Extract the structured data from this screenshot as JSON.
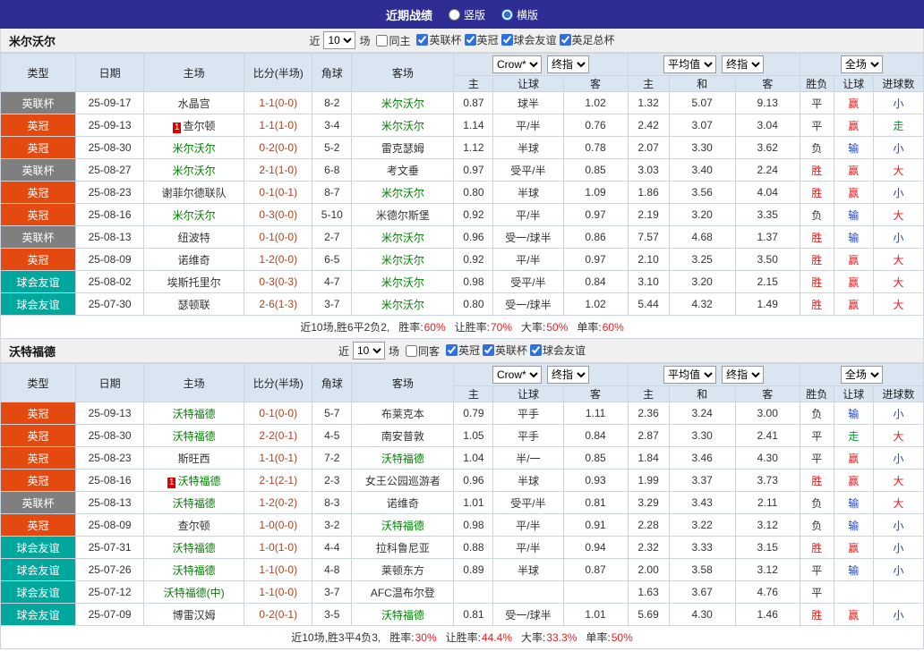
{
  "topbar": {
    "title": "近期战绩",
    "layout_options": [
      {
        "label": "竖版",
        "selected": false
      },
      {
        "label": "横版",
        "selected": true
      }
    ]
  },
  "labels": {
    "near": "近",
    "games": "场"
  },
  "selects": {
    "count": "10",
    "bookmaker": "Crow*",
    "stage": "终指",
    "average": "平均值",
    "scope": "全场"
  },
  "columns": {
    "main": [
      "类型",
      "日期",
      "主场",
      "比分(半场)",
      "角球",
      "客场"
    ],
    "sub": [
      "主",
      "让球",
      "客",
      "主",
      "和",
      "客",
      "胜负",
      "让球",
      "进球数"
    ]
  },
  "colors": {
    "topbar_bg": "#2d2d93",
    "table_header_bg": "#d9e6f2",
    "league_cup_gray": "#7f7f7f",
    "league_championship_red": "#e4490f",
    "friendly_teal": "#00a79d",
    "focal_team_green": "#008000",
    "score_color": "#aa4422",
    "win_red": "#e02020",
    "lose_blue": "#2244cc",
    "push_green": "#009933"
  },
  "sections": [
    {
      "team": "米尔沃尔",
      "same_venue": {
        "label": "同主",
        "checked": false
      },
      "leagues": [
        {
          "label": "英联杯",
          "checked": true
        },
        {
          "label": "英冠",
          "checked": true
        },
        {
          "label": "球会友谊",
          "checked": true
        },
        {
          "label": "英足总杯",
          "checked": true
        }
      ],
      "rows": [
        {
          "league": "英联杯",
          "league_color": "gray",
          "date": "25-09-17",
          "home": "水晶宫",
          "home_focal": false,
          "home_rank": "",
          "score": "1-1(0-0)",
          "corners": "8-2",
          "away": "米尔沃尔",
          "away_focal": true,
          "odds": [
            "0.87",
            "球半",
            "1.02"
          ],
          "euro": [
            "1.32",
            "5.07",
            "9.13"
          ],
          "results": [
            {
              "t": "平",
              "c": "dark"
            },
            {
              "t": "赢",
              "c": "red"
            },
            {
              "t": "小",
              "c": "blue"
            }
          ]
        },
        {
          "league": "英冠",
          "league_color": "red",
          "date": "25-09-13",
          "home": "查尔顿",
          "home_focal": false,
          "home_rank": "1",
          "score": "1-1(1-0)",
          "corners": "3-4",
          "away": "米尔沃尔",
          "away_focal": true,
          "odds": [
            "1.14",
            "平/半",
            "0.76"
          ],
          "euro": [
            "2.42",
            "3.07",
            "3.04"
          ],
          "results": [
            {
              "t": "平",
              "c": "dark"
            },
            {
              "t": "赢",
              "c": "red"
            },
            {
              "t": "走",
              "c": "green"
            }
          ]
        },
        {
          "league": "英冠",
          "league_color": "red",
          "date": "25-08-30",
          "home": "米尔沃尔",
          "home_focal": true,
          "home_rank": "",
          "score": "0-2(0-0)",
          "corners": "5-2",
          "away": "雷克瑟姆",
          "away_focal": false,
          "odds": [
            "1.12",
            "半球",
            "0.78"
          ],
          "euro": [
            "2.07",
            "3.30",
            "3.62"
          ],
          "results": [
            {
              "t": "负",
              "c": "dark"
            },
            {
              "t": "输",
              "c": "blue"
            },
            {
              "t": "小",
              "c": "blue"
            }
          ]
        },
        {
          "league": "英联杯",
          "league_color": "gray",
          "date": "25-08-27",
          "home": "米尔沃尔",
          "home_focal": true,
          "home_rank": "",
          "score": "2-1(1-0)",
          "corners": "6-8",
          "away": "考文垂",
          "away_focal": false,
          "odds": [
            "0.97",
            "受平/半",
            "0.85"
          ],
          "euro": [
            "3.03",
            "3.40",
            "2.24"
          ],
          "results": [
            {
              "t": "胜",
              "c": "red"
            },
            {
              "t": "赢",
              "c": "red"
            },
            {
              "t": "大",
              "c": "red"
            }
          ]
        },
        {
          "league": "英冠",
          "league_color": "red",
          "date": "25-08-23",
          "home": "谢菲尔德联队",
          "home_focal": false,
          "home_rank": "",
          "score": "0-1(0-1)",
          "corners": "8-7",
          "away": "米尔沃尔",
          "away_focal": true,
          "odds": [
            "0.80",
            "半球",
            "1.09"
          ],
          "euro": [
            "1.86",
            "3.56",
            "4.04"
          ],
          "results": [
            {
              "t": "胜",
              "c": "red"
            },
            {
              "t": "赢",
              "c": "red"
            },
            {
              "t": "小",
              "c": "blue"
            }
          ]
        },
        {
          "league": "英冠",
          "league_color": "red",
          "date": "25-08-16",
          "home": "米尔沃尔",
          "home_focal": true,
          "home_rank": "",
          "score": "0-3(0-0)",
          "corners": "5-10",
          "away": "米德尔斯堡",
          "away_focal": false,
          "odds": [
            "0.92",
            "平/半",
            "0.97"
          ],
          "euro": [
            "2.19",
            "3.20",
            "3.35"
          ],
          "results": [
            {
              "t": "负",
              "c": "dark"
            },
            {
              "t": "输",
              "c": "blue"
            },
            {
              "t": "大",
              "c": "red"
            }
          ]
        },
        {
          "league": "英联杯",
          "league_color": "gray",
          "date": "25-08-13",
          "home": "纽波特",
          "home_focal": false,
          "home_rank": "",
          "score": "0-1(0-0)",
          "corners": "2-7",
          "away": "米尔沃尔",
          "away_focal": true,
          "odds": [
            "0.96",
            "受一/球半",
            "0.86"
          ],
          "euro": [
            "7.57",
            "4.68",
            "1.37"
          ],
          "results": [
            {
              "t": "胜",
              "c": "red"
            },
            {
              "t": "输",
              "c": "blue"
            },
            {
              "t": "小",
              "c": "blue"
            }
          ]
        },
        {
          "league": "英冠",
          "league_color": "red",
          "date": "25-08-09",
          "home": "诺维奇",
          "home_focal": false,
          "home_rank": "",
          "score": "1-2(0-0)",
          "corners": "6-5",
          "away": "米尔沃尔",
          "away_focal": true,
          "odds": [
            "0.92",
            "平/半",
            "0.97"
          ],
          "euro": [
            "2.10",
            "3.25",
            "3.50"
          ],
          "results": [
            {
              "t": "胜",
              "c": "red"
            },
            {
              "t": "赢",
              "c": "red"
            },
            {
              "t": "大",
              "c": "red"
            }
          ]
        },
        {
          "league": "球会友谊",
          "league_color": "teal",
          "date": "25-08-02",
          "home": "埃斯托里尔",
          "home_focal": false,
          "home_rank": "",
          "score": "0-3(0-3)",
          "corners": "4-7",
          "away": "米尔沃尔",
          "away_focal": true,
          "odds": [
            "0.98",
            "受平/半",
            "0.84"
          ],
          "euro": [
            "3.10",
            "3.20",
            "2.15"
          ],
          "results": [
            {
              "t": "胜",
              "c": "red"
            },
            {
              "t": "赢",
              "c": "red"
            },
            {
              "t": "大",
              "c": "red"
            }
          ]
        },
        {
          "league": "球会友谊",
          "league_color": "teal",
          "date": "25-07-30",
          "home": "瑟顿联",
          "home_focal": false,
          "home_rank": "",
          "score": "2-6(1-3)",
          "corners": "3-7",
          "away": "米尔沃尔",
          "away_focal": true,
          "odds": [
            "0.80",
            "受一/球半",
            "1.02"
          ],
          "euro": [
            "5.44",
            "4.32",
            "1.49"
          ],
          "results": [
            {
              "t": "胜",
              "c": "red"
            },
            {
              "t": "赢",
              "c": "red"
            },
            {
              "t": "大",
              "c": "red"
            }
          ]
        }
      ],
      "summary": {
        "lead": "近10场,胜6平2负2,",
        "stats": [
          {
            "label": "胜率:",
            "value": "60%"
          },
          {
            "label": "让胜率:",
            "value": "70%"
          },
          {
            "label": "大率:",
            "value": "50%"
          },
          {
            "label": "单率:",
            "value": "60%"
          }
        ]
      }
    },
    {
      "team": "沃特福德",
      "same_venue": {
        "label": "同客",
        "checked": false
      },
      "leagues": [
        {
          "label": "英冠",
          "checked": true
        },
        {
          "label": "英联杯",
          "checked": true
        },
        {
          "label": "球会友谊",
          "checked": true
        }
      ],
      "rows": [
        {
          "league": "英冠",
          "league_color": "red",
          "date": "25-09-13",
          "home": "沃特福德",
          "home_focal": true,
          "home_rank": "",
          "score": "0-1(0-0)",
          "corners": "5-7",
          "away": "布莱克本",
          "away_focal": false,
          "odds": [
            "0.79",
            "平手",
            "1.11"
          ],
          "euro": [
            "2.36",
            "3.24",
            "3.00"
          ],
          "results": [
            {
              "t": "负",
              "c": "dark"
            },
            {
              "t": "输",
              "c": "blue"
            },
            {
              "t": "小",
              "c": "blue"
            }
          ]
        },
        {
          "league": "英冠",
          "league_color": "red",
          "date": "25-08-30",
          "home": "沃特福德",
          "home_focal": true,
          "home_rank": "",
          "score": "2-2(0-1)",
          "corners": "4-5",
          "away": "南安普敦",
          "away_focal": false,
          "odds": [
            "1.05",
            "平手",
            "0.84"
          ],
          "euro": [
            "2.87",
            "3.30",
            "2.41"
          ],
          "results": [
            {
              "t": "平",
              "c": "dark"
            },
            {
              "t": "走",
              "c": "green"
            },
            {
              "t": "大",
              "c": "red"
            }
          ]
        },
        {
          "league": "英冠",
          "league_color": "red",
          "date": "25-08-23",
          "home": "斯旺西",
          "home_focal": false,
          "home_rank": "",
          "score": "1-1(0-1)",
          "corners": "7-2",
          "away": "沃特福德",
          "away_focal": true,
          "odds": [
            "1.04",
            "半/一",
            "0.85"
          ],
          "euro": [
            "1.84",
            "3.46",
            "4.30"
          ],
          "results": [
            {
              "t": "平",
              "c": "dark"
            },
            {
              "t": "赢",
              "c": "red"
            },
            {
              "t": "小",
              "c": "blue"
            }
          ]
        },
        {
          "league": "英冠",
          "league_color": "red",
          "date": "25-08-16",
          "home": "沃特福德",
          "home_focal": true,
          "home_rank": "1",
          "score": "2-1(2-1)",
          "corners": "2-3",
          "away": "女王公园巡游者",
          "away_focal": false,
          "odds": [
            "0.96",
            "半球",
            "0.93"
          ],
          "euro": [
            "1.99",
            "3.37",
            "3.73"
          ],
          "results": [
            {
              "t": "胜",
              "c": "red"
            },
            {
              "t": "赢",
              "c": "red"
            },
            {
              "t": "大",
              "c": "red"
            }
          ]
        },
        {
          "league": "英联杯",
          "league_color": "gray",
          "date": "25-08-13",
          "home": "沃特福德",
          "home_focal": true,
          "home_rank": "",
          "score": "1-2(0-2)",
          "corners": "8-3",
          "away": "诺维奇",
          "away_focal": false,
          "odds": [
            "1.01",
            "受平/半",
            "0.81"
          ],
          "euro": [
            "3.29",
            "3.43",
            "2.11"
          ],
          "results": [
            {
              "t": "负",
              "c": "dark"
            },
            {
              "t": "输",
              "c": "blue"
            },
            {
              "t": "大",
              "c": "red"
            }
          ]
        },
        {
          "league": "英冠",
          "league_color": "red",
          "date": "25-08-09",
          "home": "查尔顿",
          "home_focal": false,
          "home_rank": "",
          "score": "1-0(0-0)",
          "corners": "3-2",
          "away": "沃特福德",
          "away_focal": true,
          "odds": [
            "0.98",
            "平/半",
            "0.91"
          ],
          "euro": [
            "2.28",
            "3.22",
            "3.12"
          ],
          "results": [
            {
              "t": "负",
              "c": "dark"
            },
            {
              "t": "输",
              "c": "blue"
            },
            {
              "t": "小",
              "c": "blue"
            }
          ]
        },
        {
          "league": "球会友谊",
          "league_color": "teal",
          "date": "25-07-31",
          "home": "沃特福德",
          "home_focal": true,
          "home_rank": "",
          "score": "1-0(1-0)",
          "corners": "4-4",
          "away": "拉科鲁尼亚",
          "away_focal": false,
          "odds": [
            "0.88",
            "平/半",
            "0.94"
          ],
          "euro": [
            "2.32",
            "3.33",
            "3.15"
          ],
          "results": [
            {
              "t": "胜",
              "c": "red"
            },
            {
              "t": "赢",
              "c": "red"
            },
            {
              "t": "小",
              "c": "blue"
            }
          ]
        },
        {
          "league": "球会友谊",
          "league_color": "teal",
          "date": "25-07-26",
          "home": "沃特福德",
          "home_focal": true,
          "home_rank": "",
          "score": "1-1(0-0)",
          "corners": "4-8",
          "away": "莱顿东方",
          "away_focal": false,
          "odds": [
            "0.89",
            "半球",
            "0.87"
          ],
          "euro": [
            "2.00",
            "3.58",
            "3.12"
          ],
          "results": [
            {
              "t": "平",
              "c": "dark"
            },
            {
              "t": "输",
              "c": "blue"
            },
            {
              "t": "小",
              "c": "blue"
            }
          ]
        },
        {
          "league": "球会友谊",
          "league_color": "teal",
          "date": "25-07-12",
          "home": "沃特福德(中)",
          "home_focal": true,
          "home_rank": "",
          "score": "1-1(0-0)",
          "corners": "3-7",
          "away": "AFC温布尔登",
          "away_focal": false,
          "odds": [
            "",
            "",
            ""
          ],
          "euro": [
            "1.63",
            "3.67",
            "4.76"
          ],
          "results": [
            {
              "t": "平",
              "c": "dark"
            },
            {
              "t": "",
              "c": "dark"
            },
            {
              "t": "",
              "c": "dark"
            }
          ]
        },
        {
          "league": "球会友谊",
          "league_color": "teal",
          "date": "25-07-09",
          "home": "博雷汉姆",
          "home_focal": false,
          "home_rank": "",
          "score": "0-2(0-1)",
          "corners": "3-5",
          "away": "沃特福德",
          "away_focal": true,
          "odds": [
            "0.81",
            "受一/球半",
            "1.01"
          ],
          "euro": [
            "5.69",
            "4.30",
            "1.46"
          ],
          "results": [
            {
              "t": "胜",
              "c": "red"
            },
            {
              "t": "赢",
              "c": "red"
            },
            {
              "t": "小",
              "c": "blue"
            }
          ]
        }
      ],
      "summary": {
        "lead": "近10场,胜3平4负3,",
        "stats": [
          {
            "label": "胜率:",
            "value": "30%"
          },
          {
            "label": "让胜率:",
            "value": "44.4%"
          },
          {
            "label": "大率:",
            "value": "33.3%"
          },
          {
            "label": "单率:",
            "value": "50%"
          }
        ]
      }
    }
  ]
}
